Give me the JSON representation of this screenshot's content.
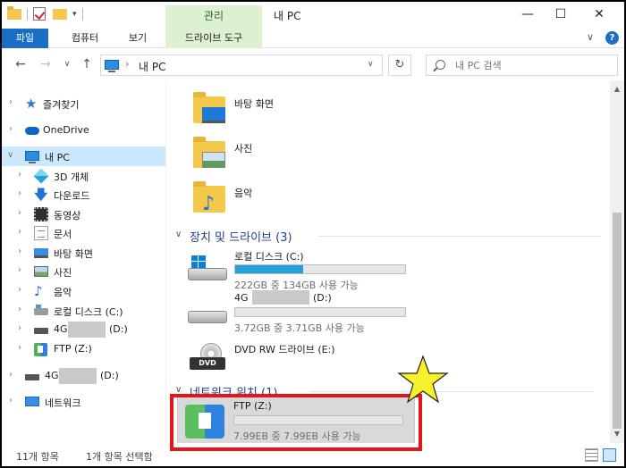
{
  "window": {
    "title": "내 PC",
    "context_tab_title": "관리"
  },
  "ribbon": {
    "tabs": [
      {
        "label": "파일"
      },
      {
        "label": "컴퓨터"
      },
      {
        "label": "보기"
      },
      {
        "label": "드라이브 도구"
      }
    ]
  },
  "address": {
    "path": "내 PC"
  },
  "search": {
    "placeholder": "내 PC 검색"
  },
  "nav": {
    "items": [
      {
        "label": "즐겨찾기"
      },
      {
        "label": "OneDrive"
      },
      {
        "label": "내 PC"
      },
      {
        "label": "3D 개체"
      },
      {
        "label": "다운로드"
      },
      {
        "label": "동영상"
      },
      {
        "label": "문서"
      },
      {
        "label": "바탕 화면"
      },
      {
        "label": "사진"
      },
      {
        "label": "음악"
      },
      {
        "label": "로컬 디스크 (C:)"
      },
      {
        "label": "4G",
        "suffix": "(D:)"
      },
      {
        "label": "FTP (Z:)"
      },
      {
        "label": "4G",
        "suffix": "(D:)"
      },
      {
        "label": "네트워크"
      }
    ]
  },
  "folders": [
    {
      "name": "바탕 화면"
    },
    {
      "name": "사진"
    },
    {
      "name": "음악"
    }
  ],
  "groups": {
    "devices": "장치 및 드라이브 (3)",
    "network": "네트워크 위치 (1)"
  },
  "drives": [
    {
      "name": "로컬 디스크 (C:)",
      "size": "222GB 중 134GB 사용 가능",
      "used_fraction": 0.4
    },
    {
      "name": "4G",
      "name_suffix": "(D:)",
      "size": "3.72GB 중 3.71GB 사용 가능",
      "used_fraction": 0.0
    },
    {
      "name": "DVD RW 드라이브 (E:)",
      "icon_label": "DVD"
    }
  ],
  "network_locations": [
    {
      "name": "FTP (Z:)",
      "size": "7.99EB 중 7.99EB 사용 가능",
      "used_fraction": 0.0
    }
  ],
  "status": {
    "count": "11개 항목",
    "selected": "1개 항목 선택함"
  },
  "colors": {
    "accent": "#1a6fc4",
    "bar_fill": "#26a0da",
    "highlight": "#e8141c",
    "star": "#f7f12a"
  }
}
